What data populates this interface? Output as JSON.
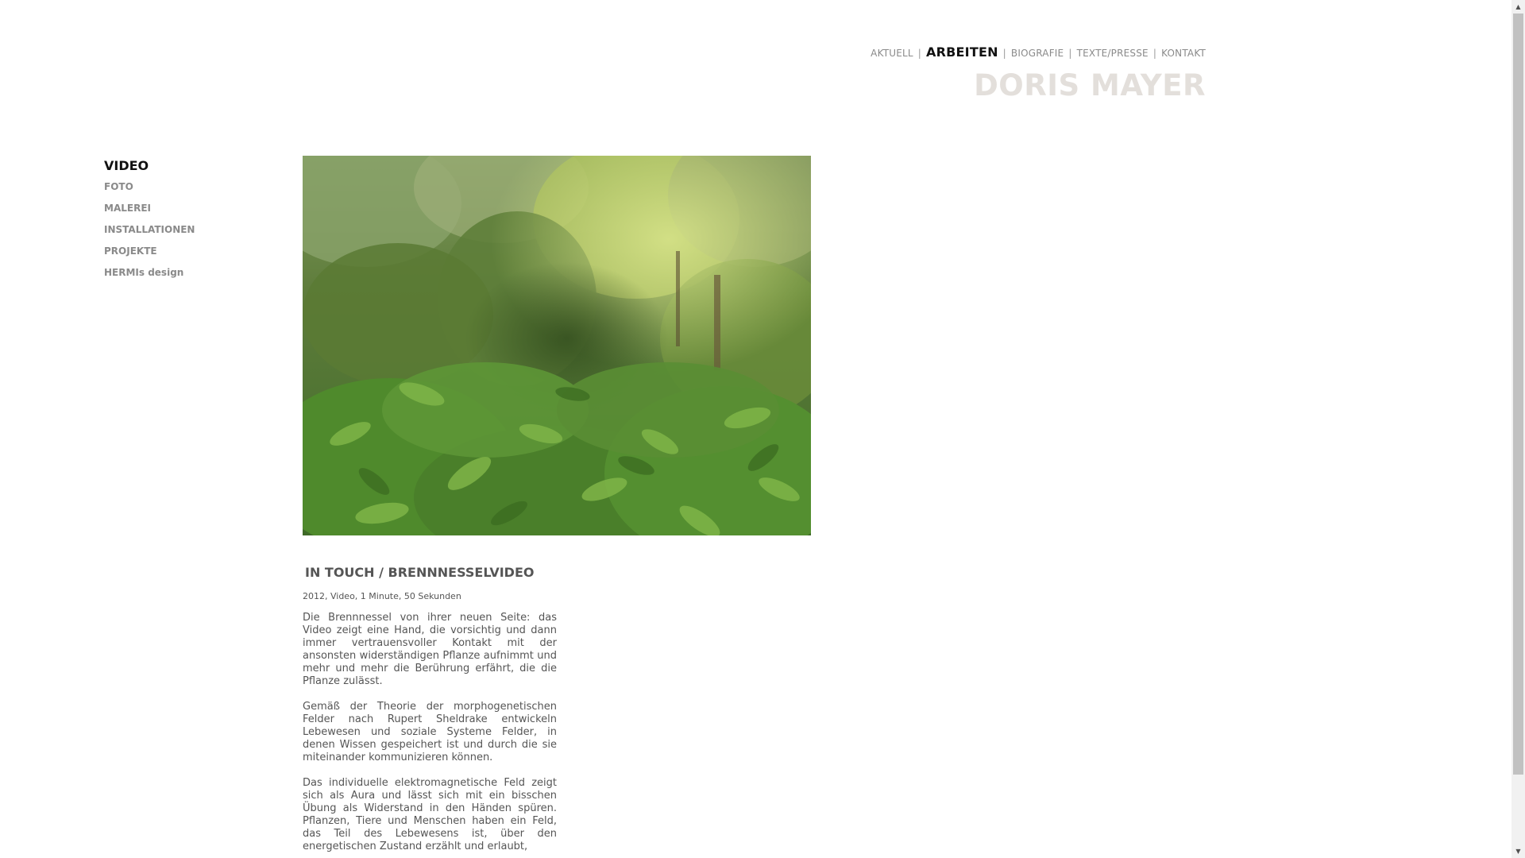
{
  "header": {
    "nav": [
      {
        "label": "AKTUELL",
        "active": false
      },
      {
        "label": "ARBEITEN",
        "active": true
      },
      {
        "label": "BIOGRAFIE",
        "active": false
      },
      {
        "label": "TEXTE/PRESSE",
        "active": false
      },
      {
        "label": "KONTAKT",
        "active": false
      }
    ],
    "separator": "|",
    "site_title": "DORIS MAYER"
  },
  "sidebar": {
    "items": [
      {
        "label": "VIDEO",
        "active": true
      },
      {
        "label": "FOTO",
        "active": false
      },
      {
        "label": "MALEREI",
        "active": false
      },
      {
        "label": "INSTALLATIONEN",
        "active": false
      },
      {
        "label": "PROJEKTE",
        "active": false
      },
      {
        "label": "HERMIs design",
        "active": false
      }
    ]
  },
  "work": {
    "title": "IN TOUCH / BRENNNESSELVIDEO",
    "meta": "2012, Video, 1 Minute, 50 Sekunden",
    "paragraphs": [
      "Die Brennnessel von ihrer neuen Seite: das Video zeigt eine Hand, die vorsichtig und dann immer vertrauensvoller Kontakt mit der ansonsten widerständigen Pflanze aufnimmt und mehr und mehr die Berührung erfährt, die die Pflanze zulässt.",
      "Gemäß der Theorie der morphogenetischen Felder nach Rupert Sheldrake entwickeln Lebewesen und soziale Systeme Felder, in denen Wissen gespeichert ist und durch die sie miteinander kommunizieren können.",
      "Das individuelle elektromagnetische Feld zeigt sich als Aura und lässt sich mit ein bisschen Übung als Widerstand in den Händen spüren. Pflanzen, Tiere und Menschen haben ein Feld, das Teil des Lebewesens ist, über den energetischen Zustand erzählt und erlaubt,"
    ]
  },
  "colors": {
    "active_text": "#111111",
    "muted_text": "#8a8a8a",
    "body_text": "#555555",
    "title_light": "#e3dfdb"
  },
  "icons": {
    "scroll_up": "scroll-up-arrow-icon",
    "scroll_down": "scroll-down-arrow-icon"
  }
}
